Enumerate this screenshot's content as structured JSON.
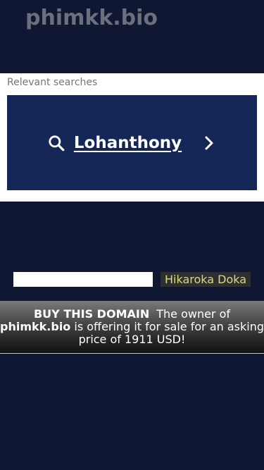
{
  "header": {
    "site_title": "phimkk.bio"
  },
  "search_panel": {
    "relevant_label": "Relevant searches",
    "items": [
      {
        "label": "Lohanthony",
        "icon_left": "search-icon",
        "icon_right": "chevron-right-icon"
      }
    ]
  },
  "keyword_bar": {
    "input_value": "",
    "keyword_link": "Hikaroka Doka"
  },
  "sale_banner": {
    "buy_label": "BUY THIS DOMAIN",
    "text_prefix": "The owner of",
    "domain": "phimkk.bio",
    "text_middle": "is offering it for sale for an asking price of",
    "price": "1911 USD!"
  },
  "colors": {
    "background": "#0f1733",
    "card": "#142756",
    "title": "#6c6f7c",
    "keyword_text": "#d8de6e"
  }
}
